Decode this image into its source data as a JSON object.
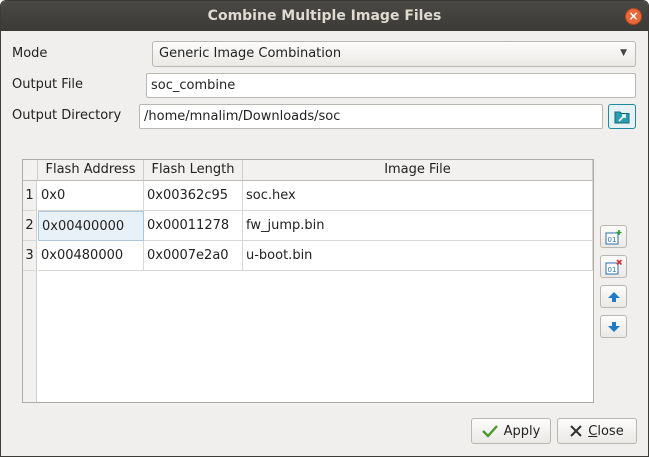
{
  "window": {
    "title": "Combine Multiple Image Files",
    "close_glyph": "×"
  },
  "form": {
    "mode_label": "Mode",
    "mode_value": "Generic Image Combination",
    "output_file_label": "Output File",
    "output_file_value": "soc_combine",
    "output_dir_label": "Output Directory",
    "output_dir_value": "/home/mnalim/Downloads/soc"
  },
  "table": {
    "columns": [
      "Flash Address",
      "Flash Length",
      "Image File"
    ],
    "rows": [
      {
        "num": "1",
        "address": "0x0",
        "length": "0x00362c95",
        "file": "soc.hex"
      },
      {
        "num": "2",
        "address": "0x00400000",
        "length": "0x00011278",
        "file": "fw_jump.bin"
      },
      {
        "num": "3",
        "address": "0x00480000",
        "length": "0x0007e2a0",
        "file": "u-boot.bin"
      }
    ],
    "selected_row": 1
  },
  "side_buttons": {
    "add_icon": "add-row-icon",
    "remove_icon": "remove-row-icon",
    "up_icon": "arrow-up-icon",
    "down_icon": "arrow-down-icon"
  },
  "buttons": {
    "apply_label": "Apply",
    "close_label_first": "C",
    "close_label_rest": "lose"
  },
  "colors": {
    "accent": "#1e8a9e",
    "titlebar": "#3c3b37",
    "close_button": "#e9683a"
  }
}
